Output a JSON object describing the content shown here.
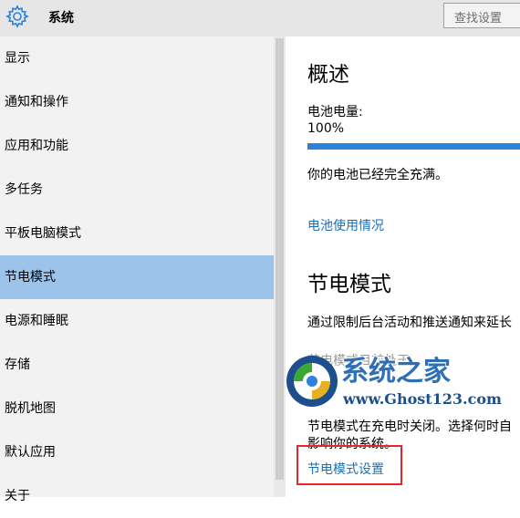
{
  "header": {
    "title": "系统",
    "search_placeholder": "查找设置"
  },
  "sidebar": {
    "items": [
      {
        "label": "显示"
      },
      {
        "label": "通知和操作"
      },
      {
        "label": "应用和功能"
      },
      {
        "label": "多任务"
      },
      {
        "label": "平板电脑模式"
      },
      {
        "label": "节电模式",
        "selected": true
      },
      {
        "label": "电源和睡眠"
      },
      {
        "label": "存储"
      },
      {
        "label": "脱机地图"
      },
      {
        "label": "默认应用"
      },
      {
        "label": "关于"
      }
    ]
  },
  "main": {
    "overview_heading": "概述",
    "battery_label": "电池电量:",
    "battery_value": "100%",
    "battery_level": 1.0,
    "battery_status": "你的电池已经完全充满。",
    "battery_usage_link": "电池使用情况",
    "saver_heading": "节电模式",
    "saver_description": "通过限制后台活动和推送通知来延长",
    "saver_status_label": "节电模式目前处于",
    "saver_info_line1": "节电模式在充电时关闭。选择何时自",
    "saver_info_line2": "影响你的系统。",
    "saver_settings_link": "节电模式设置"
  },
  "watermark": {
    "text": "系统之家",
    "url": "www.Ghost123.com"
  },
  "colors": {
    "accent": "#2b82d9",
    "selected_bg": "#9cc3ea",
    "link": "#1a6fba",
    "highlight": "#e02a2a"
  }
}
